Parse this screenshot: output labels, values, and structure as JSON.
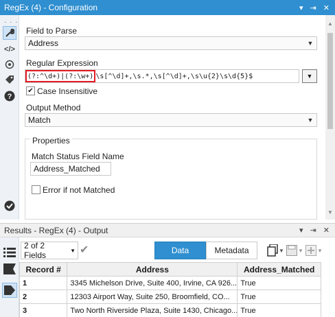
{
  "config_window": {
    "title": "RegEx (4) - Configuration",
    "controls": [
      "▾",
      "⇥",
      "✕"
    ]
  },
  "config": {
    "field_to_parse_label": "Field to Parse",
    "field_to_parse_value": "Address",
    "regex_label": "Regular Expression",
    "regex_highlight": "(?:^\\d+)|(?:\\w+)",
    "regex_rest": "\\s[^\\d]+,\\s.*,\\s[^\\d]+,\\s\\u{2}\\s\\d{5}$",
    "case_insensitive_label": "Case Insensitive",
    "case_insensitive_checked": true,
    "output_method_label": "Output Method",
    "output_method_value": "Match",
    "properties_label": "Properties",
    "match_status_label": "Match Status Field Name",
    "match_status_value": "Address_Matched",
    "error_if_not_matched_label": "Error if not Matched",
    "error_if_not_matched_checked": false
  },
  "output_window": {
    "title": "Results - RegEx (4) - Output",
    "controls": [
      "▾",
      "⇥",
      "✕"
    ]
  },
  "output": {
    "fields_selector": "2 of 2 Fields",
    "tab_data": "Data",
    "tab_metadata": "Metadata",
    "columns": [
      "Record #",
      "Address",
      "Address_Matched"
    ],
    "rows": [
      {
        "record": "1",
        "address": "3345 Michelson Drive, Suite 400, Irvine, CA 926...",
        "matched": "True"
      },
      {
        "record": "2",
        "address": "12303 Airport Way, Suite 250, Broomfield, CO...",
        "matched": "True"
      },
      {
        "record": "3",
        "address": "Two North Riverside Plaza, Suite 1430, Chicago...",
        "matched": "True"
      }
    ]
  },
  "colors": {
    "titlebar": "#2f8fd0",
    "active_tab": "#2f8fd0",
    "highlight_box": "#e31b23"
  }
}
